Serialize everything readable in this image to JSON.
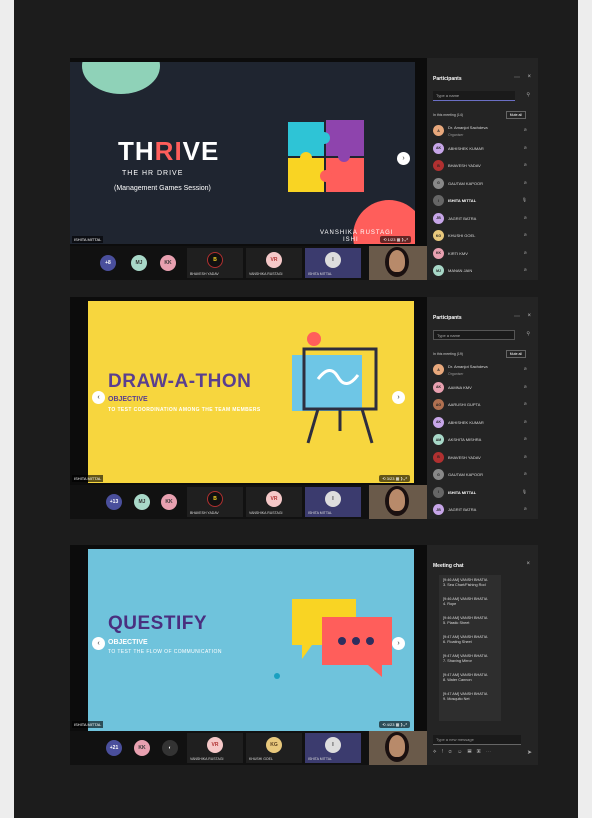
{
  "screens": [
    {
      "slide": {
        "title_parts": [
          "TH",
          "RI",
          "VE"
        ],
        "subtitle": "THE HR DRIVE",
        "session": "(Management Games Session)",
        "presenter": "VANSHIKA RUSTAGI",
        "presenter2": "ISHI",
        "speaker_tag": "ISHITA MITTAL",
        "controls": "⟲ 1/23 ▦ ⟫ ⤢"
      },
      "bar": {
        "bubbles": [
          "+8",
          "MJ",
          "KK"
        ],
        "tiles": [
          {
            "initials": "B",
            "label": "BHAVESH YADAV"
          },
          {
            "initials": "VR",
            "label": "VANSHIKA RUSTAGI"
          },
          {
            "initials": "I",
            "label": "ISHITA MITTAL"
          }
        ]
      },
      "panel": {
        "title": "Participants",
        "search_placeholder": "Type a name",
        "meeting_label": "In this meeting (14)",
        "mute_label": "Mute all",
        "people": [
          {
            "initials": "A",
            "name": "Dr. Amanjot Sachdeva",
            "role": "Organiser",
            "color": "#e8a87c"
          },
          {
            "initials": "AK",
            "name": "ABHISHEK KUMAR",
            "color": "#c7a6e8"
          },
          {
            "initials": "B",
            "name": "BHAVESH YADAV",
            "color": "#b03030"
          },
          {
            "initials": "G",
            "name": "GAUTAM KAPOOR",
            "color": "#888"
          },
          {
            "initials": "I",
            "name": "ISHITA MITTAL",
            "color": "#666",
            "bold": true
          },
          {
            "initials": "JB",
            "name": "JAGRIT BATRA",
            "color": "#c7a6e8"
          },
          {
            "initials": "KG",
            "name": "KHUSHI GOEL",
            "color": "#e8c87c"
          },
          {
            "initials": "KK",
            "name": "KIRTI KMV",
            "color": "#e8a0b0"
          },
          {
            "initials": "MJ",
            "name": "MANAN JAIN",
            "color": "#a8d8c8"
          }
        ]
      }
    },
    {
      "slide": {
        "title": "DRAW-A-THON",
        "objective": "OBJECTIVE",
        "objective_text": "TO TEST COORDINATION AMONG THE TEAM MEMBERS",
        "speaker_tag": "ISHITA MITTAL",
        "controls": "⟲ 3/23 ▦ ⟫ ⤢"
      },
      "bar": {
        "bubbles": [
          "+13",
          "MJ",
          "KK"
        ],
        "tiles": [
          {
            "initials": "B",
            "label": "BHAVESH YADAV"
          },
          {
            "initials": "VR",
            "label": "VANSHIKA RUSTAGI"
          },
          {
            "initials": "I",
            "label": "ISHITA MITTAL"
          }
        ]
      },
      "panel": {
        "title": "Participants",
        "search_placeholder": "Type a name",
        "meeting_label": "In this meeting (19)",
        "mute_label": "Mute all",
        "people": [
          {
            "initials": "A",
            "name": "Dr. Amanjot Sachdeva",
            "role": "Organiser",
            "color": "#e8a87c"
          },
          {
            "initials": "AK",
            "name": "AAMNA KMV",
            "color": "#e8a0b0"
          },
          {
            "initials": "AG",
            "name": "AARUSHI GUPTA",
            "color": "#b07050"
          },
          {
            "initials": "AK",
            "name": "ABHISHEK KUMAR",
            "color": "#c7a6e8"
          },
          {
            "initials": "AM",
            "name": "AKSHITA MISHRA",
            "color": "#a8d8c8"
          },
          {
            "initials": "B",
            "name": "BHAVESH YADAV",
            "color": "#b03030"
          },
          {
            "initials": "G",
            "name": "GAUTAM KAPOOR",
            "color": "#888"
          },
          {
            "initials": "I",
            "name": "ISHITA MITTAL",
            "color": "#666",
            "bold": true
          },
          {
            "initials": "JB",
            "name": "JAGRIT BATRA",
            "color": "#c7a6e8"
          }
        ]
      }
    },
    {
      "slide": {
        "title": "QUESTIFY",
        "objective": "OBJECTIVE",
        "objective_text": "TO TEST THE FLOW OF COMMUNICATION",
        "speaker_tag": "ISHITA MITTAL",
        "controls": "⟲ 4/23 ▦ ⟫ ⤢"
      },
      "bar": {
        "bubbles": [
          "+21",
          "KK"
        ],
        "tiles": [
          {
            "initials": "VR",
            "label": "VANSHIKA RUSTAGI"
          },
          {
            "initials": "KG",
            "label": "KHUSHI GOEL"
          },
          {
            "initials": "I",
            "label": "ISHITA MITTAL"
          }
        ]
      },
      "chat": {
        "title": "Meeting chat",
        "messages": [
          {
            "head": "[9:46 AM] VANSH BHATIA",
            "text": "3. Sea Chart/Fishing Rod"
          },
          {
            "head": "[9:46 AM] VANSH BHATIA",
            "text": "4. Rope"
          },
          {
            "head": "[9:46 AM] VANSH BHATIA",
            "text": "5. Plastic Sheet"
          },
          {
            "head": "[9:47 AM] VANSH BHATIA",
            "text": "6. Floating Sheet"
          },
          {
            "head": "[9:47 AM] VANSH BHATIA",
            "text": "7. Shaving Mirror"
          },
          {
            "head": "[9:47 AM] VANSH BHATIA",
            "text": "8. Water Cannon"
          },
          {
            "head": "[9:47 AM] VANSH BHATIA",
            "text": "9. Mosquito Net"
          }
        ],
        "input_placeholder": "Type a new message"
      }
    }
  ]
}
